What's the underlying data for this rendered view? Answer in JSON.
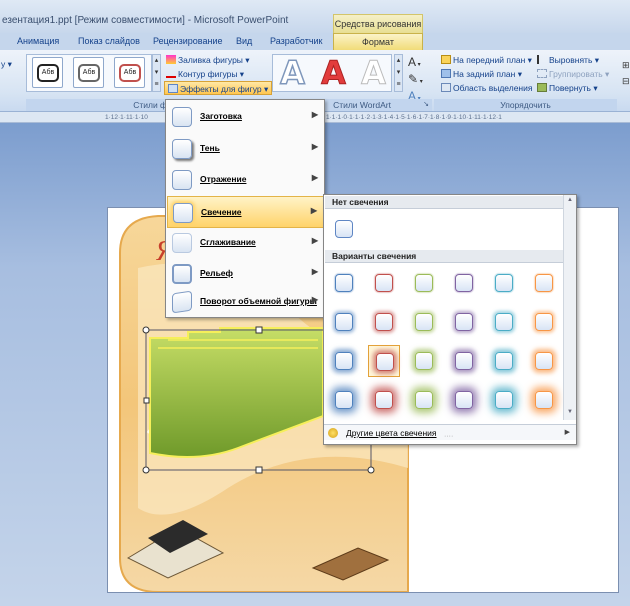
{
  "window": {
    "title": "езентация1.ppt [Режим совместимости] - Microsoft PowerPoint",
    "context_tab_group": "Средства рисования"
  },
  "tabs": [
    "Анимация",
    "Показ слайдов",
    "Рецензирование",
    "Вид",
    "Разработчик",
    "Формат"
  ],
  "ribbon": {
    "shape_styles": {
      "group_label": "Стили фигур",
      "left_dropdown": "у ▾",
      "presets": [
        "Абв",
        "Абв",
        "Абв"
      ],
      "fill": "Заливка фигуры ▾",
      "outline": "Контур фигуры ▾",
      "effects": "Эффекты для фигур ▾"
    },
    "wordart": {
      "group_label": "Стили WordArt",
      "letters": [
        "A",
        "A",
        "A"
      ]
    },
    "arrange": {
      "group_label": "Упорядочить",
      "bring_front": "На передний план ▾",
      "send_back": "На задний план ▾",
      "selection_pane": "Область выделения",
      "align": "Выровнять ▾",
      "group": "Группировать ▾",
      "rotate": "Повернуть ▾"
    }
  },
  "ruler": {
    "left": "1·12·1·11·1·10",
    "right": "1·1·1·0·1·1·1·2·1·3·1·4·1·5·1·6·1·7·1·8·1·9·1·10·1·11·1·12·1"
  },
  "effects_menu": {
    "items": [
      {
        "label": "Заготовка"
      },
      {
        "label": "Тень"
      },
      {
        "label": "Отражение"
      },
      {
        "label": "Свечение"
      },
      {
        "label": "Сглаживание"
      },
      {
        "label": "Рельеф"
      },
      {
        "label": "Поворот объемной фигуры"
      }
    ],
    "selected": "Свечение"
  },
  "glow_gallery": {
    "no_glow_header": "Нет свечения",
    "variants_header": "Варианты свечения",
    "more_colors": "Другие цвета свечения",
    "colors": [
      "#4f81bd",
      "#c0504d",
      "#9bbb59",
      "#8064a2",
      "#4bacc6",
      "#f79646"
    ],
    "selected_row": 2,
    "selected_col": 1
  }
}
